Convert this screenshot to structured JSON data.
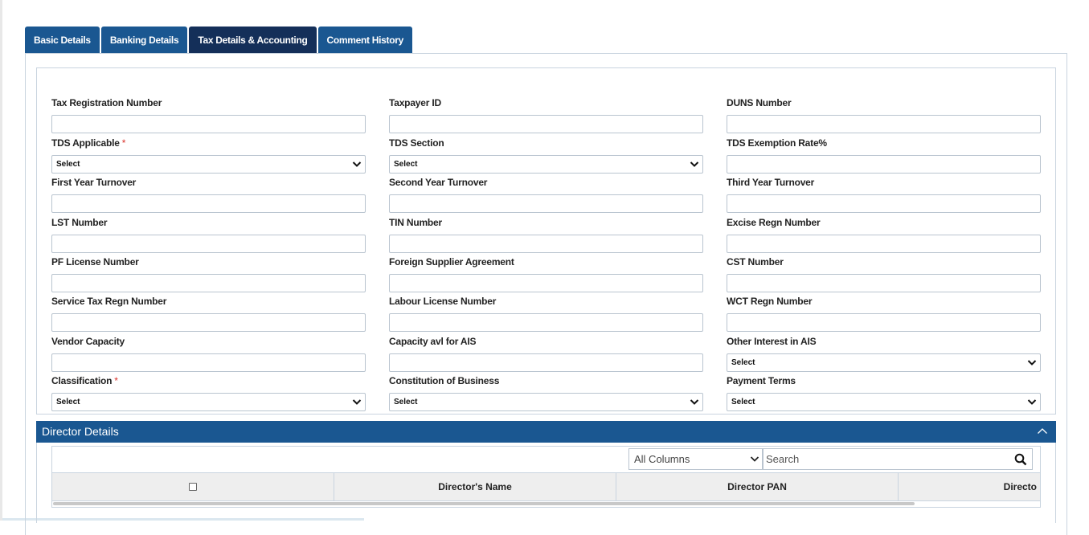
{
  "tabs": [
    {
      "label": "Basic Details"
    },
    {
      "label": "Banking Details"
    },
    {
      "label": "Tax Details & Accounting"
    },
    {
      "label": "Comment History"
    }
  ],
  "form": {
    "tax_registration_number": {
      "label": "Tax Registration Number",
      "value": ""
    },
    "taxpayer_id": {
      "label": "Taxpayer ID",
      "value": ""
    },
    "duns_number": {
      "label": "DUNS Number",
      "value": ""
    },
    "tds_applicable": {
      "label": "TDS Applicable",
      "required_mark": "*",
      "selected": "Select"
    },
    "tds_section": {
      "label": "TDS Section",
      "selected": "Select"
    },
    "tds_exemption_rate": {
      "label": "TDS Exemption Rate%",
      "value": ""
    },
    "first_year_turnover": {
      "label": "First Year Turnover",
      "value": ""
    },
    "second_year_turnover": {
      "label": "Second Year Turnover",
      "value": ""
    },
    "third_year_turnover": {
      "label": "Third Year Turnover",
      "value": ""
    },
    "lst_number": {
      "label": "LST Number",
      "value": ""
    },
    "tin_number": {
      "label": "TIN Number",
      "value": ""
    },
    "excise_regn_number": {
      "label": "Excise Regn Number",
      "value": ""
    },
    "pf_license_number": {
      "label": "PF License Number",
      "value": ""
    },
    "foreign_supplier_agreement": {
      "label": "Foreign Supplier Agreement",
      "value": ""
    },
    "cst_number": {
      "label": "CST Number",
      "value": ""
    },
    "service_tax_regn_number": {
      "label": "Service Tax Regn Number",
      "value": ""
    },
    "labour_license_number": {
      "label": "Labour License Number",
      "value": ""
    },
    "wct_regn_number": {
      "label": "WCT Regn Number",
      "value": ""
    },
    "vendor_capacity": {
      "label": "Vendor Capacity",
      "value": ""
    },
    "capacity_avl_for_ais": {
      "label": "Capacity avl for AIS",
      "value": ""
    },
    "other_interest_in_ais": {
      "label": "Other Interest in AIS",
      "selected": "Select"
    },
    "classification": {
      "label": "Classification",
      "required_mark": "*",
      "selected": "Select"
    },
    "constitution_of_business": {
      "label": "Constitution of Business",
      "selected": "Select"
    },
    "payment_terms": {
      "label": "Payment Terms",
      "selected": "Select"
    }
  },
  "director_details": {
    "title": "Director Details",
    "column_filter": "All Columns",
    "search_placeholder": "Search",
    "columns": [
      "Director's Name",
      "Director PAN",
      "Directo"
    ]
  },
  "colors": {
    "tab": "#1a5791",
    "tab_active": "#142f59",
    "required": "#d9322b"
  },
  "icons": [
    "chevron-down-icon",
    "chevron-up-icon",
    "search-icon",
    "checkbox-icon"
  ]
}
